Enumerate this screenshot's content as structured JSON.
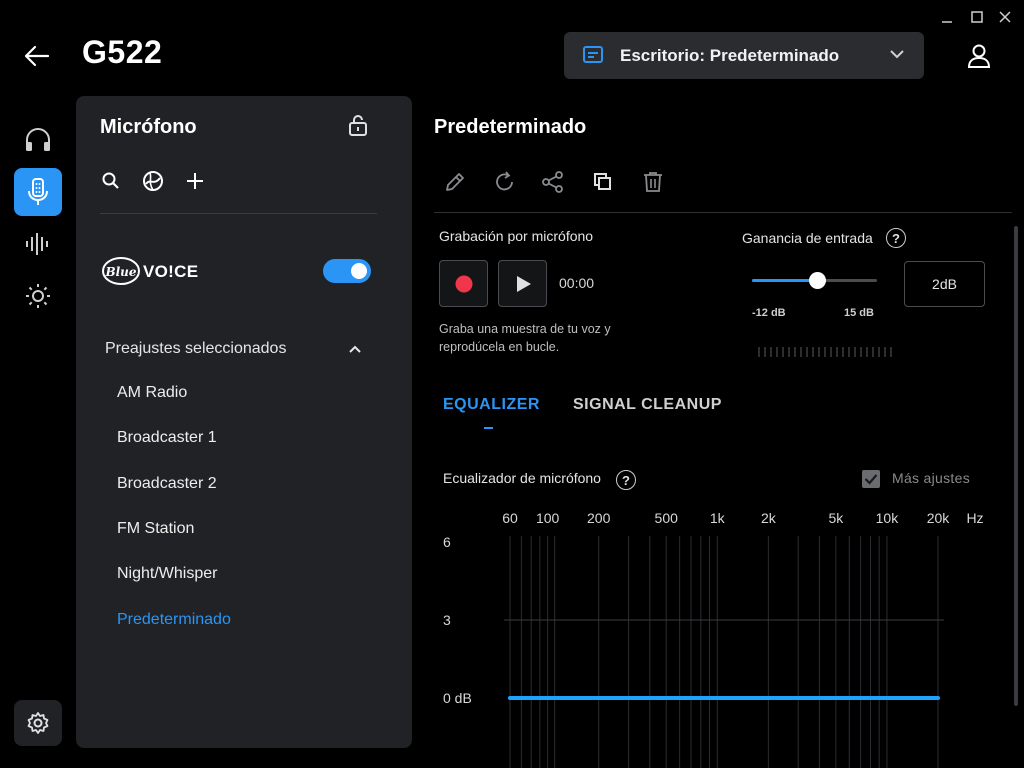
{
  "window": {
    "minimize_icon": "minimize-icon",
    "maximize_icon": "maximize-icon",
    "close_icon": "close-icon"
  },
  "header": {
    "device_name": "G522",
    "profile_label": "Escritorio: Predeterminado"
  },
  "rail": {
    "items": [
      "headphones-icon",
      "microphone-icon",
      "equalizer-icon",
      "lighting-icon"
    ],
    "active": "microphone-icon",
    "settings_icon": "settings-gear-icon"
  },
  "left_panel": {
    "title": "Micrófono",
    "blue_voice": {
      "logo_text": "Blue",
      "label": "VO!CE",
      "enabled": true
    },
    "presets_header": "Preajustes seleccionados",
    "presets": [
      "AM Radio",
      "Broadcaster 1",
      "Broadcaster 2",
      "FM Station",
      "Night/Whisper",
      "Predeterminado"
    ],
    "selected_preset": "Predeterminado"
  },
  "main": {
    "title": "Predeterminado",
    "recording": {
      "label": "Grabación por micrófono",
      "timer": "00:00",
      "hint": "Graba una muestra de tu voz y reprodúcela en bucle."
    },
    "gain": {
      "label": "Ganancia de entrada",
      "help": "?",
      "min_label": "-12 dB",
      "max_label": "15 dB",
      "value": "2dB",
      "level_fraction": 0.52
    },
    "tabs": [
      "EQUALIZER",
      "SIGNAL CLEANUP"
    ],
    "active_tab": "EQUALIZER",
    "eq": {
      "label": "Ecualizador de micrófono",
      "help": "?",
      "more_settings": "Más ajustes",
      "more_settings_checked": true
    }
  },
  "chart_data": {
    "type": "line",
    "title": "",
    "x_scale": "log",
    "x_tick_labels": [
      "60",
      "100",
      "200",
      "500",
      "1k",
      "2k",
      "5k",
      "10k",
      "20k"
    ],
    "x_unit_label": "Hz",
    "y_tick_labels": [
      "6",
      "3",
      "0 dB"
    ],
    "y_ticks": [
      6,
      3,
      0
    ],
    "series": [
      {
        "x": [
          60,
          20000
        ],
        "y": [
          0,
          0
        ],
        "color": "#1ea3ff"
      }
    ],
    "grid": true
  }
}
